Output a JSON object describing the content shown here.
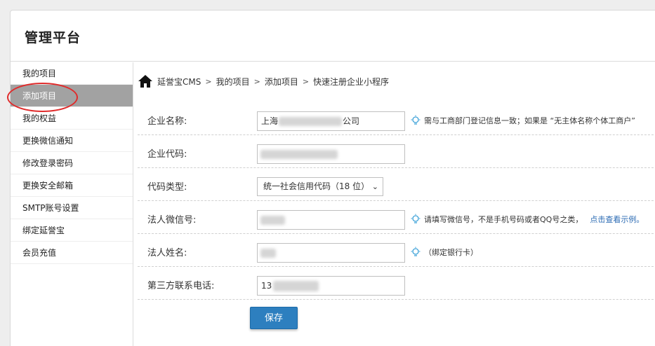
{
  "header": {
    "title": "管理平台"
  },
  "sidebar": {
    "items": [
      {
        "label": "我的项目"
      },
      {
        "label": "添加项目"
      },
      {
        "label": "我的权益"
      },
      {
        "label": "更换微信通知"
      },
      {
        "label": "修改登录密码"
      },
      {
        "label": "更换安全邮箱"
      },
      {
        "label": "SMTP账号设置"
      },
      {
        "label": "绑定延誉宝"
      },
      {
        "label": "会员充值"
      }
    ]
  },
  "breadcrumb": {
    "icon": "home-icon",
    "items": [
      "延誉宝CMS",
      "我的项目",
      "添加项目",
      "快速注册企业小程序"
    ],
    "separator": ">"
  },
  "form": {
    "company_name": {
      "label": "企业名称:",
      "value_prefix": "上海",
      "value_suffix": "公司",
      "hint": "需与工商部门登记信息一致；如果是 “无主体名称个体工商户”"
    },
    "company_code": {
      "label": "企业代码:"
    },
    "code_type": {
      "label": "代码类型:",
      "selected": "统一社会信用代码（18 位）"
    },
    "legal_wechat": {
      "label": "法人微信号:",
      "hint": "请填写微信号，不是手机号码或者QQ号之类，",
      "link": "点击查看示例。"
    },
    "legal_name": {
      "label": "法人姓名:",
      "hint": "（绑定银行卡）"
    },
    "phone": {
      "label": "第三方联系电话:",
      "value_prefix": "13"
    },
    "save_label": "保存"
  }
}
